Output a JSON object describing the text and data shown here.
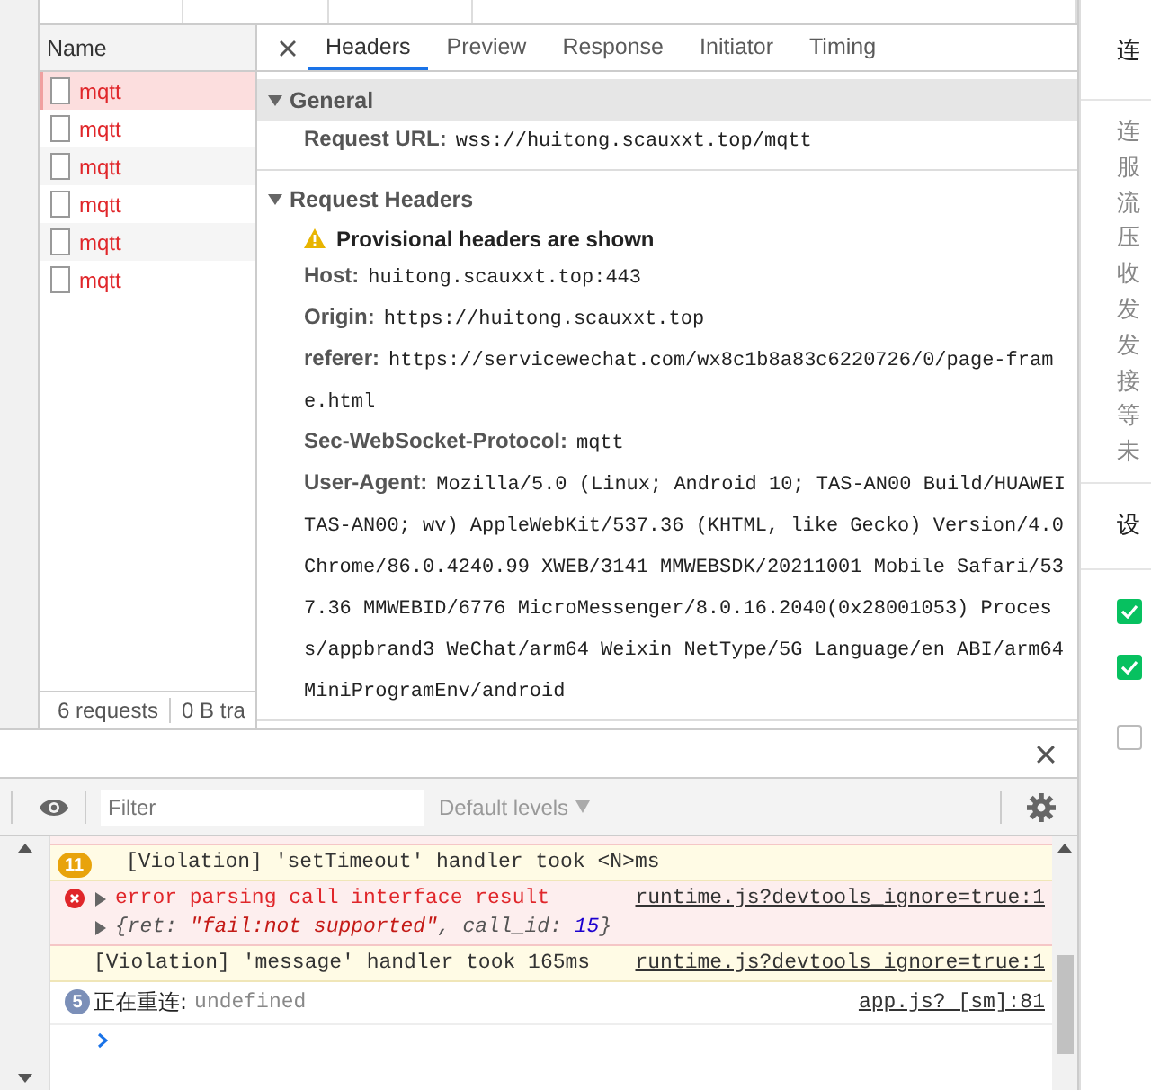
{
  "network": {
    "name_column": {
      "header": "Name",
      "requests": [
        {
          "name": "mqtt",
          "selected": true
        },
        {
          "name": "mqtt",
          "selected": false
        },
        {
          "name": "mqtt",
          "selected": false
        },
        {
          "name": "mqtt",
          "selected": false
        },
        {
          "name": "mqtt",
          "selected": false
        },
        {
          "name": "mqtt",
          "selected": false
        }
      ]
    },
    "status_bar": {
      "requests": "6 requests",
      "transferred": "0 B tra"
    }
  },
  "details": {
    "tabs": [
      {
        "label": "Headers",
        "selected": true
      },
      {
        "label": "Preview",
        "selected": false
      },
      {
        "label": "Response",
        "selected": false
      },
      {
        "label": "Initiator",
        "selected": false
      },
      {
        "label": "Timing",
        "selected": false
      }
    ],
    "sections": [
      {
        "title": "General",
        "expanded": true,
        "rows": [
          {
            "key": "Request URL:",
            "value": "wss://huitong.scauxxt.top/mqtt"
          }
        ]
      },
      {
        "title": "Request Headers",
        "expanded": true,
        "warning": "Provisional headers are shown",
        "rows": [
          {
            "key": "Host:",
            "value": "huitong.scauxxt.top:443"
          },
          {
            "key": "Origin:",
            "value": "https://huitong.scauxxt.top"
          },
          {
            "key": "referer:",
            "value": "https://servicewechat.com/wx8c1b8a83c6220726/0/page-frame.html"
          },
          {
            "key": "Sec-WebSocket-Protocol:",
            "value": "mqtt"
          },
          {
            "key": "User-Agent:",
            "value": "Mozilla/5.0 (Linux; Android 10; TAS-AN00 Build/HUAWEITAS-AN00; wv) AppleWebKit/537.36 (KHTML, like Gecko) Version/4.0 Chrome/86.0.4240.99 XWEB/3141 MMWEBSDK/20211001 Mobile Safari/537.36 MMWEBID/6776 MicroMessenger/8.0.16.2040(0x28001053) Process/appbrand3 WeChat/arm64 Weixin NetType/5G Language/en ABI/arm64 MiniProgramEnv/android"
          }
        ]
      }
    ]
  },
  "console": {
    "filter": {
      "placeholder": "Filter"
    },
    "levels": "Default levels",
    "messages": [
      {
        "kind": "violation",
        "count": "11",
        "text": "[Violation] 'setTimeout' handler took <N>ms"
      },
      {
        "kind": "error",
        "text": "error parsing call interface result",
        "source": "runtime.js?devtools_ignore=true:1",
        "object": [
          {
            "text": "{ret: ",
            "kind": "plain"
          },
          {
            "text": "\"fail:not supported\"",
            "kind": "string"
          },
          {
            "text": ", call_id: ",
            "kind": "plain"
          },
          {
            "text": "15",
            "kind": "number"
          },
          {
            "text": "}",
            "kind": "plain"
          }
        ]
      },
      {
        "kind": "violation",
        "text": "[Violation] 'message' handler took 165ms",
        "source": "runtime.js?devtools_ignore=true:1"
      },
      {
        "kind": "info",
        "count": "5",
        "text": "正在重连:",
        "value": "undefined",
        "source": "app.js? [sm]:81"
      }
    ]
  },
  "side_panel": {
    "header": "连",
    "stats": [
      "连",
      "服",
      "流",
      "压",
      "收",
      "发",
      "发",
      "接",
      "等",
      "未"
    ],
    "settings_header": "设",
    "checkboxes": [
      {
        "checked": true
      },
      {
        "checked": true
      },
      {
        "checked": false
      }
    ]
  }
}
